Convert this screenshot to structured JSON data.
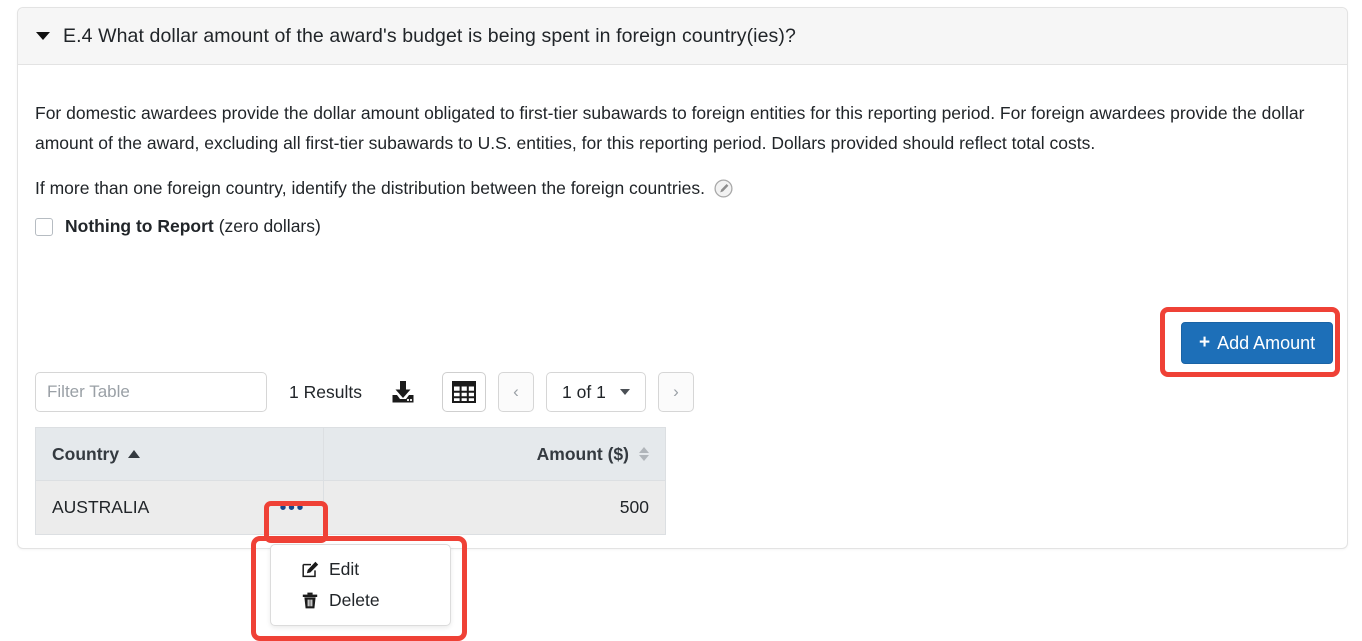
{
  "panel": {
    "title": "E.4 What dollar amount of the award's budget is being spent in foreign country(ies)?",
    "collapse_icon": "caret-down-icon"
  },
  "content": {
    "paragraph_1": "For domestic awardees provide the dollar amount obligated to first-tier subawards to foreign entities for this reporting period. For foreign awardees provide the dollar amount of the award, excluding all first-tier subawards to U.S. entities, for this reporting period. Dollars provided should reflect total costs.",
    "paragraph_2": "If more than one foreign country, identify the distribution between the foreign countries.",
    "help_icon": "help-info-icon"
  },
  "checkbox": {
    "label_strong": "Nothing to Report",
    "label_rest": "(zero dollars)",
    "checked": false
  },
  "actions": {
    "add_amount_label": "Add Amount",
    "add_amount_plus": "+"
  },
  "toolbar": {
    "filter_placeholder": "Filter Table",
    "filter_value": "",
    "results_label": "1 Results",
    "download_icon": "download-icon",
    "grid_icon": "table-grid-icon",
    "prev_label": "‹",
    "next_label": "›",
    "page_value": "1 of 1"
  },
  "table": {
    "columns": [
      {
        "label": "Country",
        "sort": "asc",
        "align": "left"
      },
      {
        "label": "Amount ($)",
        "sort": "none",
        "align": "right"
      }
    ],
    "rows": [
      {
        "country": "AUSTRALIA",
        "amount": "500",
        "kebab": "•••"
      }
    ]
  },
  "row_menu": {
    "items": [
      {
        "label": "Edit",
        "icon": "edit-pencil-icon"
      },
      {
        "label": "Delete",
        "icon": "trash-icon"
      }
    ]
  },
  "colors": {
    "highlight": "#ef4136",
    "primary_button": "#1d6fb8",
    "header_bg": "#f6f6f6",
    "table_header_bg": "#e5e9ec",
    "table_row_bg": "#ececec",
    "kebab": "#17478a"
  }
}
